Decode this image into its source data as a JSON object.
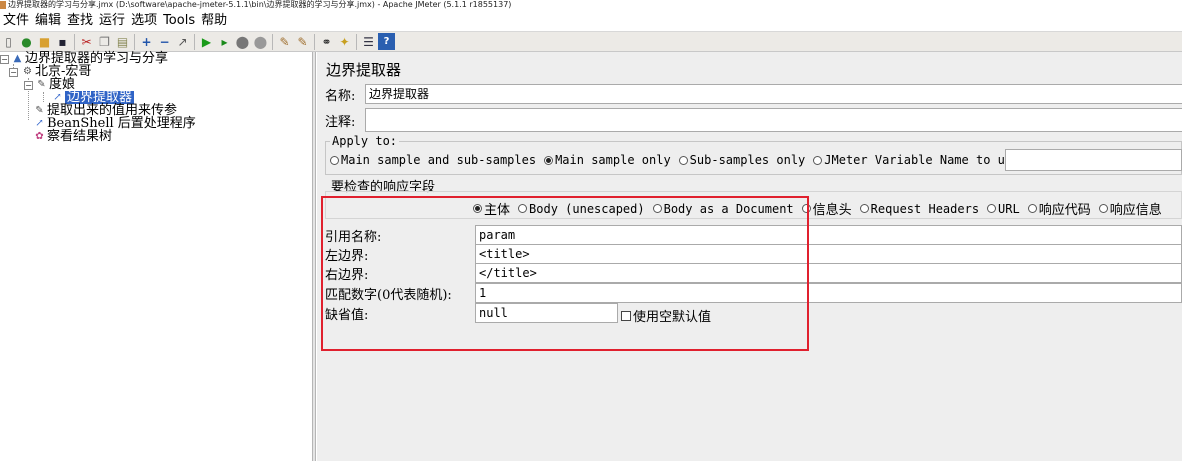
{
  "window": {
    "title": "边界提取器的学习与分享.jmx (D:\\software\\apache-jmeter-5.1.1\\bin\\边界提取器的学习与分享.jmx) - Apache JMeter (5.1.1 r1855137)"
  },
  "menu": [
    "文件",
    "编辑",
    "查找",
    "运行",
    "选项",
    "Tools",
    "帮助"
  ],
  "toolbar_icons": [
    "new-icon",
    "templates-icon",
    "open-icon",
    "save-icon",
    "cut-icon",
    "copy-icon",
    "paste-icon",
    "expand-icon",
    "collapse-icon",
    "toggle-icon",
    "start-icon",
    "start-no-pause-icon",
    "stop-icon",
    "shutdown-icon",
    "clear-icon",
    "clear-all-icon",
    "search-icon",
    "reset-search-icon",
    "function-helper-icon",
    "help-icon"
  ],
  "tree": {
    "root": "边界提取器的学习与分享",
    "thread_group": "北京-宏哥",
    "sampler": "度娘",
    "selected": "边界提取器",
    "extra1": "提取出来的值用来传参",
    "extra2": "BeanShell 后置处理程序",
    "listener": "察看结果树"
  },
  "panel": {
    "title": "边界提取器",
    "name_label": "名称:",
    "name_value": "边界提取器",
    "comment_label": "注释:",
    "comment_value": "",
    "apply_to_label": "Apply to:",
    "apply_to_options": [
      "Main sample and sub-samples",
      "Main sample only",
      "Sub-samples only",
      "JMeter Variable Name to use"
    ],
    "apply_to_selected": 1,
    "field_label": "要检查的响应字段",
    "field_options": [
      "主体",
      "Body (unescaped)",
      "Body as a Document",
      "信息头",
      "Request Headers",
      "URL",
      "响应代码",
      "响应信息"
    ],
    "field_selected": 0,
    "ref_name_label": "引用名称:",
    "ref_name_value": "param",
    "left_boundary_label": "左边界:",
    "left_boundary_value": "<title>",
    "right_boundary_label": "右边界:",
    "right_boundary_value": "</title>",
    "match_no_label": "匹配数字(0代表随机):",
    "match_no_value": "1",
    "default_label": "缺省值:",
    "default_value": "null",
    "use_empty_label": "使用空默认值"
  }
}
